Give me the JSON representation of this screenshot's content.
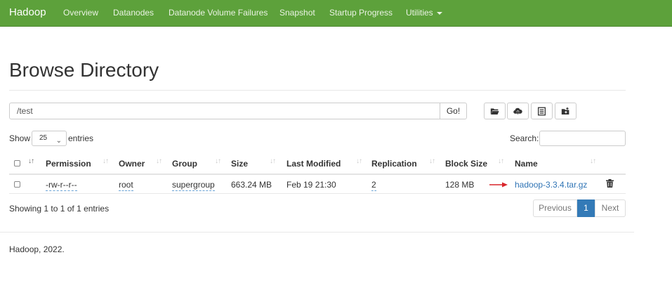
{
  "navbar": {
    "brand": "Hadoop",
    "items": [
      "Overview",
      "Datanodes",
      "Datanode Volume Failures",
      "Snapshot",
      "Startup Progress",
      "Utilities"
    ]
  },
  "page": {
    "title": "Browse Directory"
  },
  "path_bar": {
    "value": "/test",
    "go_label": "Go!"
  },
  "toolbar": {
    "buttons": [
      "folder-open-icon",
      "upload-icon",
      "list-icon",
      "create-folder-icon"
    ]
  },
  "table_controls": {
    "show_label": "Show",
    "length_value": "25",
    "entries_label": "entries",
    "search_label": "Search:"
  },
  "table": {
    "headers": [
      "Permission",
      "Owner",
      "Group",
      "Size",
      "Last Modified",
      "Replication",
      "Block Size",
      "Name"
    ],
    "rows": [
      {
        "permission": "-rw-r--r--",
        "owner": "root",
        "group": "supergroup",
        "size": "663.24 MB",
        "last_modified": "Feb 19 21:30",
        "replication": "2",
        "block_size": "128 MB",
        "name": "hadoop-3.3.4.tar.gz"
      }
    ]
  },
  "pagination": {
    "info": "Showing 1 to 1 of 1 entries",
    "previous": "Previous",
    "current": "1",
    "next": "Next"
  },
  "footer": {
    "text": "Hadoop, 2022."
  },
  "colors": {
    "navbar": "#5da13b",
    "link": "#2f74b5",
    "accent": "#337ab7",
    "arrow": "#d9262c"
  }
}
